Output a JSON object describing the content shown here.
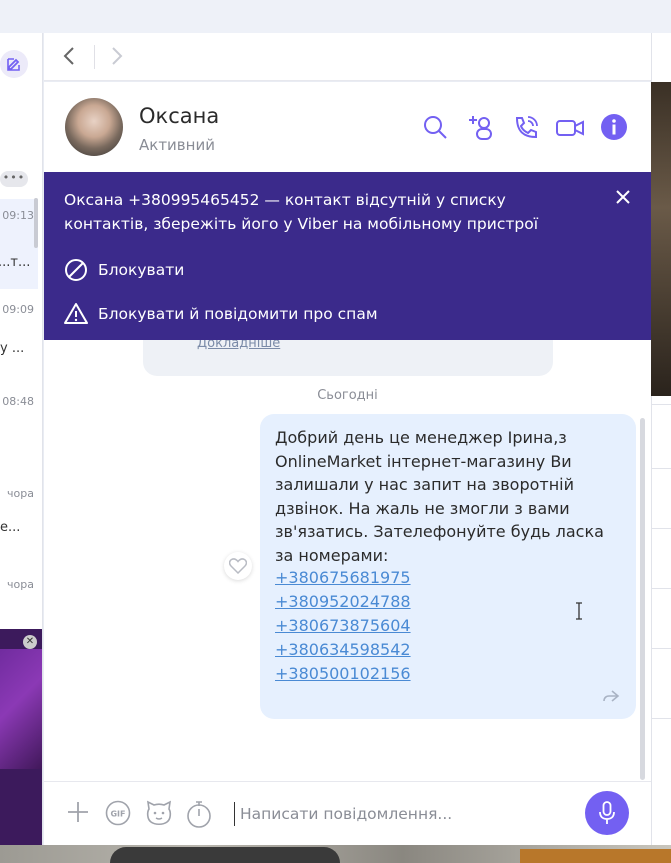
{
  "contact": {
    "name": "Оксана",
    "status": "Активний"
  },
  "banner": {
    "message": "Оксана +380995465452 — контакт відсутній у списку контактів, збережіть його у Viber на мобільному пристрої",
    "block_label": "Блокувати",
    "block_report_label": "Блокувати й повідомити про спам"
  },
  "left_pane": {
    "dots": "•••",
    "items": [
      {
        "time": "09:13",
        "preview": "...т..."
      },
      {
        "time": "09:09",
        "preview": "у ..."
      },
      {
        "time": "08:48",
        "preview": ""
      },
      {
        "time": "чора",
        "preview": "е..."
      },
      {
        "time": "чора",
        "preview": ""
      }
    ]
  },
  "previous_link": "Докладніше",
  "date_separator": "Сьогодні",
  "message": {
    "text": "Добрий день це менеджер Ірина,з OnlineMarket інтернет-магазину  Ви залишали у нас запит на зворотній дзвінок. На жаль не змогли з вами зв'язатись. Зателефонуйте будь ласка за номерами:",
    "phones": [
      "+380675681975",
      "+380952024788",
      "+380673875604",
      "+380634598542",
      "+380500102156"
    ]
  },
  "composer": {
    "placeholder": "Написати повідомлення..."
  },
  "colors": {
    "accent": "#7360f2",
    "banner": "#3b2a8b",
    "bubble": "#e6f0fe",
    "link": "#4a8ad4"
  },
  "icons": [
    "compose-icon",
    "back-arrow-icon",
    "forward-arrow-icon",
    "search-icon",
    "add-participant-icon",
    "call-icon",
    "video-call-icon",
    "info-icon",
    "close-icon",
    "block-icon",
    "warning-icon",
    "heart-icon",
    "forward-message-icon",
    "plus-icon",
    "gif-icon",
    "sticker-icon",
    "timer-icon",
    "microphone-icon"
  ]
}
